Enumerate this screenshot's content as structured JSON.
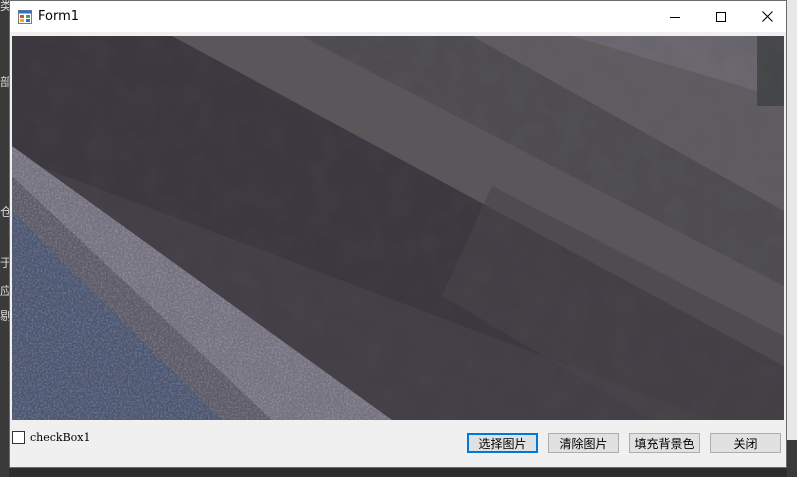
{
  "window": {
    "title": "Form1"
  },
  "form": {
    "checkbox_label": "checkBox1",
    "checkbox_checked": false,
    "buttons": {
      "select_image": "选择图片",
      "clear_image": "清除图片",
      "fill_background": "填充背景色",
      "close": "关闭"
    }
  },
  "background_fragments": {
    "left_chars": [
      "类",
      "部",
      "仓",
      "于",
      "应",
      "剔"
    ]
  },
  "colors": {
    "accent": "#0078d7",
    "window_bg": "#f0f0f0",
    "titlebar_bg": "#ffffff"
  },
  "icons": [
    "app-form-icon",
    "minimize-icon",
    "maximize-icon",
    "close-icon"
  ]
}
